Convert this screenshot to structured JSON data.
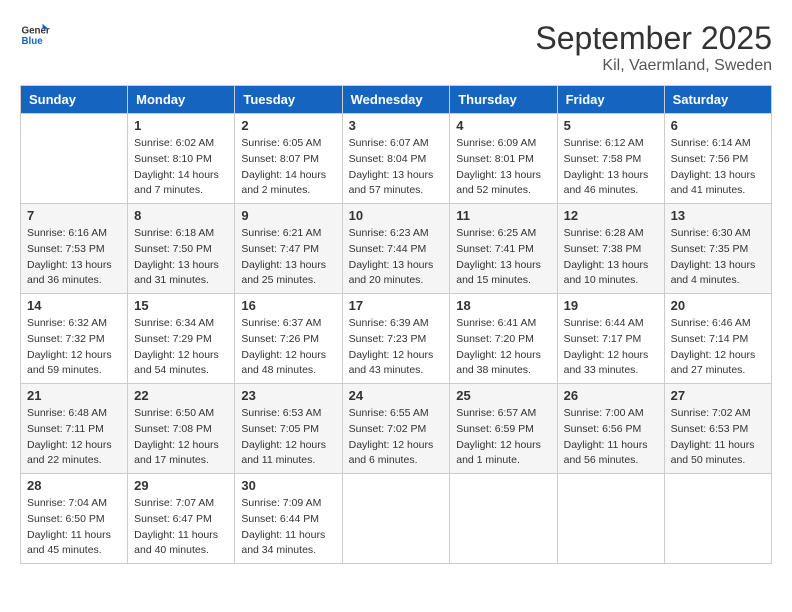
{
  "header": {
    "logo_line1": "General",
    "logo_line2": "Blue",
    "month": "September 2025",
    "location": "Kil, Vaermland, Sweden"
  },
  "days_of_week": [
    "Sunday",
    "Monday",
    "Tuesday",
    "Wednesday",
    "Thursday",
    "Friday",
    "Saturday"
  ],
  "weeks": [
    [
      {
        "day": "",
        "info": ""
      },
      {
        "day": "1",
        "info": "Sunrise: 6:02 AM\nSunset: 8:10 PM\nDaylight: 14 hours\nand 7 minutes."
      },
      {
        "day": "2",
        "info": "Sunrise: 6:05 AM\nSunset: 8:07 PM\nDaylight: 14 hours\nand 2 minutes."
      },
      {
        "day": "3",
        "info": "Sunrise: 6:07 AM\nSunset: 8:04 PM\nDaylight: 13 hours\nand 57 minutes."
      },
      {
        "day": "4",
        "info": "Sunrise: 6:09 AM\nSunset: 8:01 PM\nDaylight: 13 hours\nand 52 minutes."
      },
      {
        "day": "5",
        "info": "Sunrise: 6:12 AM\nSunset: 7:58 PM\nDaylight: 13 hours\nand 46 minutes."
      },
      {
        "day": "6",
        "info": "Sunrise: 6:14 AM\nSunset: 7:56 PM\nDaylight: 13 hours\nand 41 minutes."
      }
    ],
    [
      {
        "day": "7",
        "info": "Sunrise: 6:16 AM\nSunset: 7:53 PM\nDaylight: 13 hours\nand 36 minutes."
      },
      {
        "day": "8",
        "info": "Sunrise: 6:18 AM\nSunset: 7:50 PM\nDaylight: 13 hours\nand 31 minutes."
      },
      {
        "day": "9",
        "info": "Sunrise: 6:21 AM\nSunset: 7:47 PM\nDaylight: 13 hours\nand 25 minutes."
      },
      {
        "day": "10",
        "info": "Sunrise: 6:23 AM\nSunset: 7:44 PM\nDaylight: 13 hours\nand 20 minutes."
      },
      {
        "day": "11",
        "info": "Sunrise: 6:25 AM\nSunset: 7:41 PM\nDaylight: 13 hours\nand 15 minutes."
      },
      {
        "day": "12",
        "info": "Sunrise: 6:28 AM\nSunset: 7:38 PM\nDaylight: 13 hours\nand 10 minutes."
      },
      {
        "day": "13",
        "info": "Sunrise: 6:30 AM\nSunset: 7:35 PM\nDaylight: 13 hours\nand 4 minutes."
      }
    ],
    [
      {
        "day": "14",
        "info": "Sunrise: 6:32 AM\nSunset: 7:32 PM\nDaylight: 12 hours\nand 59 minutes."
      },
      {
        "day": "15",
        "info": "Sunrise: 6:34 AM\nSunset: 7:29 PM\nDaylight: 12 hours\nand 54 minutes."
      },
      {
        "day": "16",
        "info": "Sunrise: 6:37 AM\nSunset: 7:26 PM\nDaylight: 12 hours\nand 48 minutes."
      },
      {
        "day": "17",
        "info": "Sunrise: 6:39 AM\nSunset: 7:23 PM\nDaylight: 12 hours\nand 43 minutes."
      },
      {
        "day": "18",
        "info": "Sunrise: 6:41 AM\nSunset: 7:20 PM\nDaylight: 12 hours\nand 38 minutes."
      },
      {
        "day": "19",
        "info": "Sunrise: 6:44 AM\nSunset: 7:17 PM\nDaylight: 12 hours\nand 33 minutes."
      },
      {
        "day": "20",
        "info": "Sunrise: 6:46 AM\nSunset: 7:14 PM\nDaylight: 12 hours\nand 27 minutes."
      }
    ],
    [
      {
        "day": "21",
        "info": "Sunrise: 6:48 AM\nSunset: 7:11 PM\nDaylight: 12 hours\nand 22 minutes."
      },
      {
        "day": "22",
        "info": "Sunrise: 6:50 AM\nSunset: 7:08 PM\nDaylight: 12 hours\nand 17 minutes."
      },
      {
        "day": "23",
        "info": "Sunrise: 6:53 AM\nSunset: 7:05 PM\nDaylight: 12 hours\nand 11 minutes."
      },
      {
        "day": "24",
        "info": "Sunrise: 6:55 AM\nSunset: 7:02 PM\nDaylight: 12 hours\nand 6 minutes."
      },
      {
        "day": "25",
        "info": "Sunrise: 6:57 AM\nSunset: 6:59 PM\nDaylight: 12 hours\nand 1 minute."
      },
      {
        "day": "26",
        "info": "Sunrise: 7:00 AM\nSunset: 6:56 PM\nDaylight: 11 hours\nand 56 minutes."
      },
      {
        "day": "27",
        "info": "Sunrise: 7:02 AM\nSunset: 6:53 PM\nDaylight: 11 hours\nand 50 minutes."
      }
    ],
    [
      {
        "day": "28",
        "info": "Sunrise: 7:04 AM\nSunset: 6:50 PM\nDaylight: 11 hours\nand 45 minutes."
      },
      {
        "day": "29",
        "info": "Sunrise: 7:07 AM\nSunset: 6:47 PM\nDaylight: 11 hours\nand 40 minutes."
      },
      {
        "day": "30",
        "info": "Sunrise: 7:09 AM\nSunset: 6:44 PM\nDaylight: 11 hours\nand 34 minutes."
      },
      {
        "day": "",
        "info": ""
      },
      {
        "day": "",
        "info": ""
      },
      {
        "day": "",
        "info": ""
      },
      {
        "day": "",
        "info": ""
      }
    ]
  ]
}
